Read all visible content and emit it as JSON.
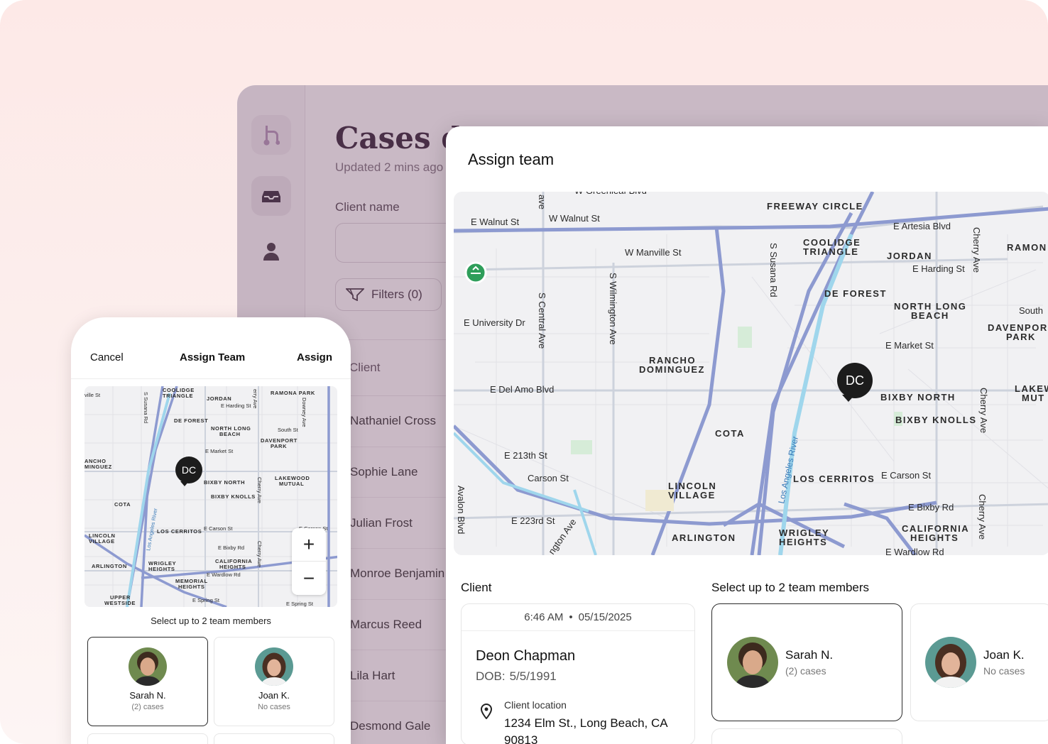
{
  "app": {
    "dashboard_title": "Cases da",
    "updated": "Updated 2 mins ago",
    "client_name_label": "Client name",
    "filters_label": "Filters (0)",
    "table_header": "Client",
    "rows": [
      "Nathaniel Cross",
      "Sophie Lane",
      "Julian Frost",
      "Monroe Benjamin",
      "Marcus Reed",
      "Lila Hart",
      "Desmond Gale"
    ],
    "sidebar_icons": [
      "logo-icon",
      "inbox-icon",
      "user-icon"
    ]
  },
  "modal": {
    "title": "Assign team",
    "client_section": "Client",
    "team_section": "Select up to 2 team members",
    "client": {
      "time": "6:46 AM",
      "date": "05/15/2025",
      "name": "Deon Chapman",
      "dob_label": "DOB:",
      "dob": "5/5/1991",
      "location_label": "Client location",
      "address": "1234 Elm St., Long Beach, CA 90813"
    },
    "members": [
      {
        "name": "Sarah N.",
        "cases": "(2) cases",
        "selected": true
      },
      {
        "name": "Joan K.",
        "cases": "No cases",
        "selected": false
      }
    ]
  },
  "map": {
    "marker": "DC",
    "streets": [
      "E Walnut St",
      "W Walnut St",
      "W Manville St",
      "E University Dr",
      "S Central Ave",
      "S Wilmington Ave",
      "S Susana Rd",
      "E Del Amo Blvd",
      "E 213th St",
      "Carson St",
      "E 223rd St",
      "Avalon Blvd",
      "E Artesia Blvd",
      "E Harding St",
      "E Market St",
      "E Carson St",
      "E Bixby Rd",
      "E Wardlow Rd",
      "Cherry Ave",
      "Los Angeles River",
      "ngton Ave",
      "W Greenleaf Blvd",
      "ave"
    ],
    "areas": [
      "FREEWAY CIRCLE",
      "COOLIDGE",
      "TRIANGLE",
      "JORDAN",
      "RAMON",
      "DE FOREST",
      "NORTH LONG",
      "BEACH",
      "South",
      "DAVENPOR",
      "PARK",
      "RANCHO",
      "DOMINGUEZ",
      "BIXBY NORTH",
      "LAKEW",
      "MUT",
      "BIXBY KNOLLS",
      "COTA",
      "LINCOLN",
      "VILLAGE",
      "LOS CERRITOS",
      "CALIFORNIA",
      "HEIGHTS",
      "ARLINGTON",
      "WRIGLEY",
      "HEIGHTS"
    ]
  },
  "phone": {
    "cancel": "Cancel",
    "title": "Assign Team",
    "assign": "Assign",
    "select_label": "Select up to 2 team members",
    "zoom_in": "+",
    "zoom_out": "−",
    "members": [
      {
        "name": "Sarah N.",
        "cases": "(2) cases",
        "selected": true
      },
      {
        "name": "Joan K.",
        "cases": "No cases",
        "selected": false
      }
    ],
    "map_labels": [
      "ville St",
      "S Susana Rd",
      "COOLIDGE",
      "TRIANGLE",
      "JORDAN",
      "E Harding St",
      "erry Ave",
      "RAMONA PARK",
      "Downey Ave",
      "DE FOREST",
      "NORTH LONG",
      "BEACH",
      "South St",
      "DAVENPORT",
      "PARK",
      "E Market St",
      "ANCHO",
      "MINGUEZ",
      "DC",
      "BIXBY NORTH",
      "LAKEWOOD",
      "MUTUAL",
      "BIXBY KNOLLS",
      "Cherry Ave",
      "COTA",
      "Los Angeles River",
      "LINCOLN",
      "VILLAGE",
      "LOS CERRITOS",
      "E Carson St",
      "E Bixby Rd",
      "Cherry Ave",
      "ARLINGTON",
      "WRIGLEY",
      "HEIGHTS",
      "CALIFORNIA",
      "HEIGHTS",
      "E Wardlow Rd",
      "MEMORIAL",
      "HEIGHTS",
      "UPPER",
      "WESTSIDE",
      "E Spring St",
      "E Spring St",
      "E Carson St"
    ]
  }
}
